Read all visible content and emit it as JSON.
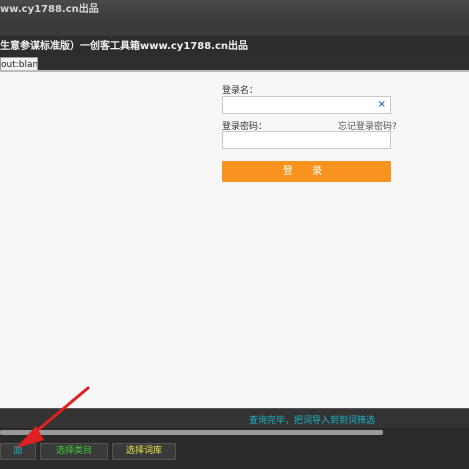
{
  "window": {
    "title": "ww.cy1788.cn出品"
  },
  "header": {
    "subtitle": "生意参谋标准版）一创客工具箱www.cy1788.cn出品"
  },
  "tab": {
    "label": "out:blank"
  },
  "login": {
    "username_label": "登录名：",
    "username_value": "",
    "clear_icon": "×",
    "password_label": "登录密码：",
    "forgot_link": "忘记登录密码?",
    "password_value": "",
    "submit_label": "登 录"
  },
  "status": {
    "message": "查询完毕，把词导入到到词筛选"
  },
  "bottom": {
    "btn1_label": "面",
    "btn2_label": "选择类目",
    "btn3_label": "选择词库"
  },
  "colors": {
    "accent": "#f7931e",
    "status": "#1fb5c9",
    "annotation": "#e02020",
    "btn_green": "#3ad13a",
    "btn_yellow": "#e8e84a"
  },
  "icons": {
    "clear": "close-icon",
    "annotation": "red-arrow-annotation"
  }
}
